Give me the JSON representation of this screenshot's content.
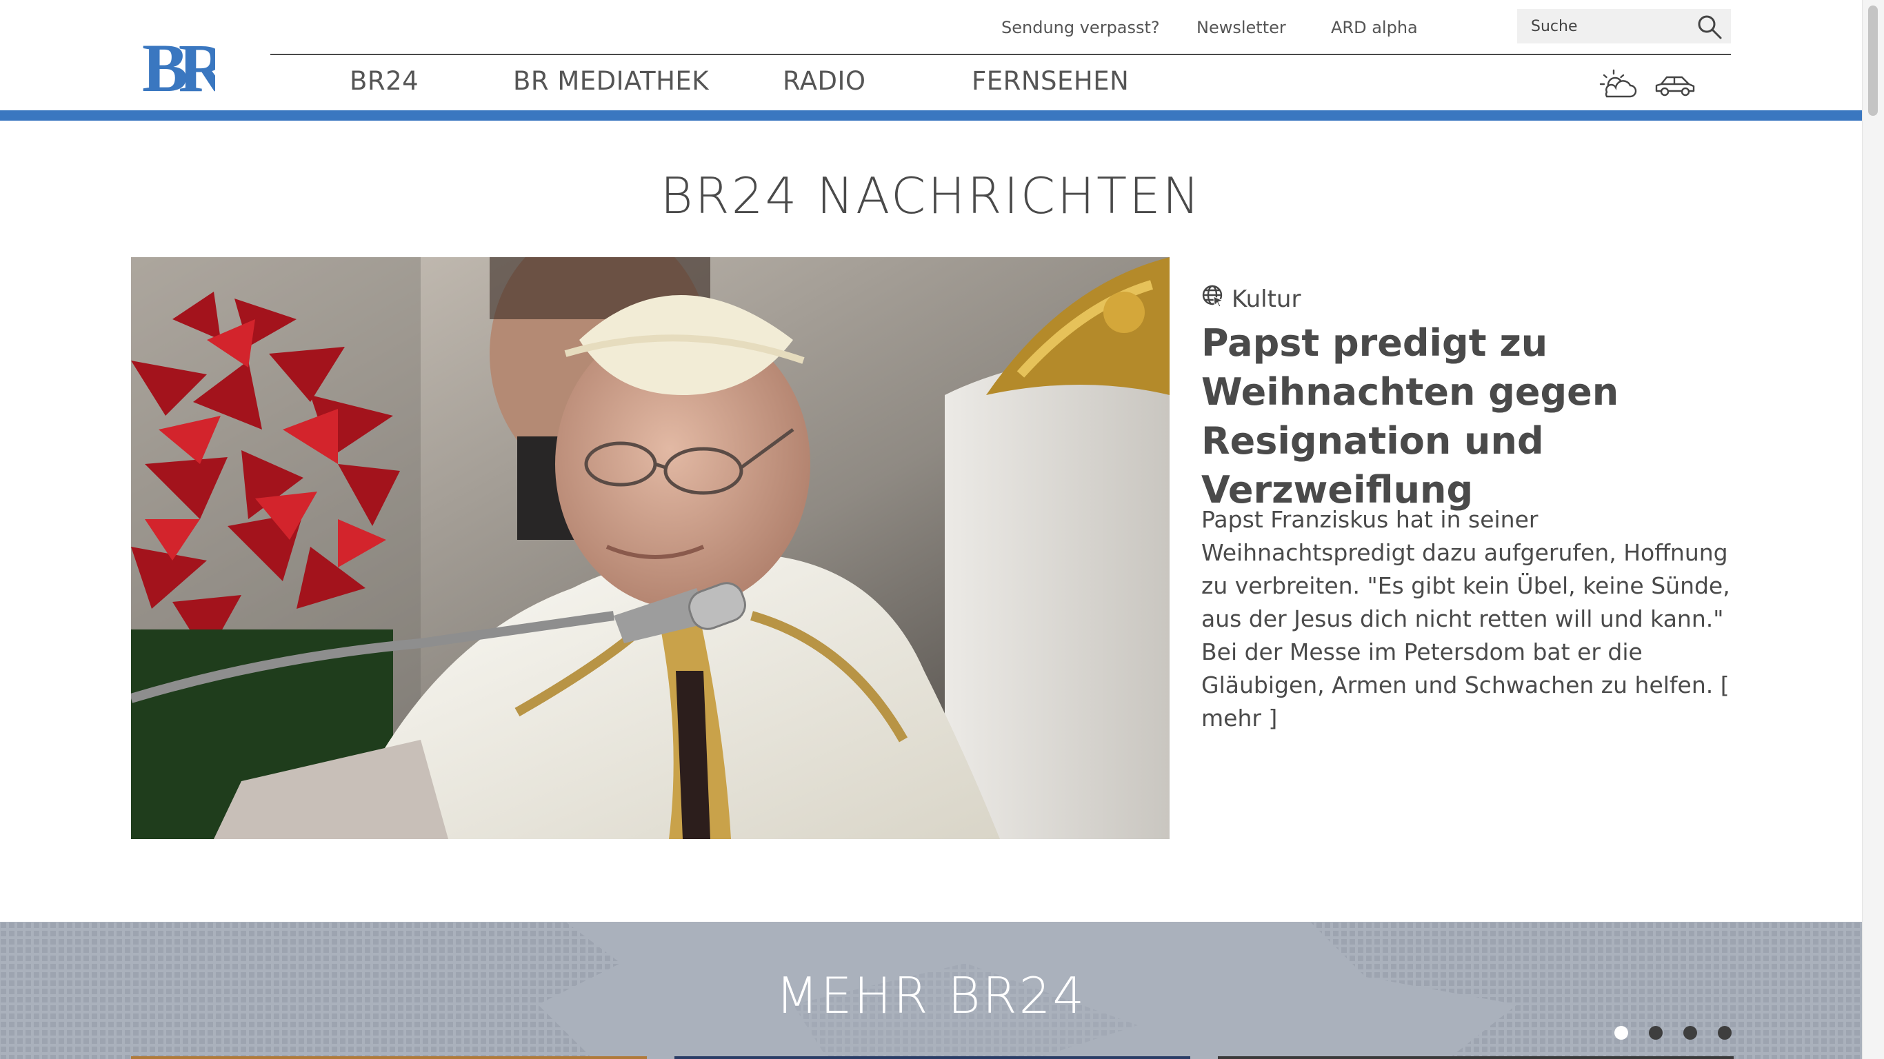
{
  "brand": {
    "logo_text": "BR",
    "accent_color": "#3a77c0"
  },
  "top_links": [
    "Sendung verpasst?",
    "Newsletter",
    "ARD alpha"
  ],
  "search": {
    "placeholder": "Suche",
    "icon": "search-icon"
  },
  "main_nav": [
    "BR24",
    "BR MEDIATHEK",
    "RADIO",
    "FERNSEHEN"
  ],
  "header_icons": [
    "weather-icon",
    "traffic-icon"
  ],
  "section_title": "BR24 NACHRICHTEN",
  "article": {
    "category": "Kultur",
    "category_icon": "globe-icon",
    "headline": "Papst predigt zu Weihnachten gegen Resignation und Verzweiflung",
    "summary": "Papst Franziskus hat in seiner Weihnachtspredigt dazu aufgerufen, Hoffnung zu verbreiten. \"Es gibt kein Übel, keine Sünde, aus der Jesus dich nicht retten will und kann.\" Bei der Messe im Petersdom bat er die Gläubigen, Armen und Schwachen zu helfen.",
    "more_label": "[ mehr ]"
  },
  "more_section": {
    "title": "MEHR BR24",
    "slides": 4,
    "active_slide": 1
  }
}
